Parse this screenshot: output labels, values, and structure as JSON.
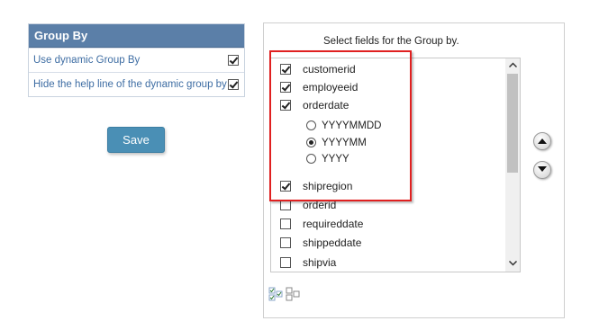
{
  "groupby_panel": {
    "title": "Group By",
    "rows": [
      {
        "label": "Use dynamic Group By",
        "checked": true
      },
      {
        "label": "Hide the help line of the dynamic group by",
        "checked": true
      }
    ]
  },
  "save_button": "Save",
  "fields_panel": {
    "title": "Select fields for the Group by.",
    "fields": [
      {
        "label": "customerid",
        "checked": true
      },
      {
        "label": "employeeid",
        "checked": true
      },
      {
        "label": "orderdate",
        "checked": true
      },
      {
        "label": "shipregion",
        "checked": true
      },
      {
        "label": "orderid",
        "checked": false
      },
      {
        "label": "requireddate",
        "checked": false
      },
      {
        "label": "shippeddate",
        "checked": false
      },
      {
        "label": "shipvia",
        "checked": false
      }
    ],
    "date_format_options": [
      {
        "label": "YYYYMMDD",
        "selected": false
      },
      {
        "label": "YYYYMM",
        "selected": true
      },
      {
        "label": "YYYY",
        "selected": false
      }
    ]
  },
  "icons": {
    "move_up": "arrow-up-icon",
    "move_down": "arrow-down-icon",
    "check_all": "check-all-icon",
    "uncheck_all": "uncheck-all-icon",
    "scroll_up": "scroll-up-arrow-icon",
    "scroll_down": "scroll-down-arrow-icon"
  },
  "colors": {
    "panel_header": "#5b7fa8",
    "save_button": "#4a8fb5",
    "highlight": "#e02020",
    "link_text": "#3e6da3"
  }
}
